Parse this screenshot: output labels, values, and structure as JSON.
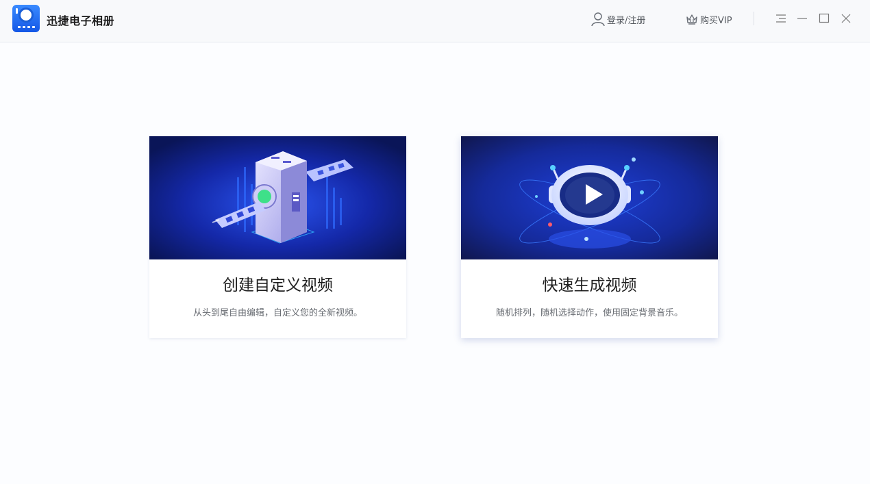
{
  "app": {
    "title": "迅捷电子相册"
  },
  "header": {
    "login_label": "登录/注册",
    "vip_label": "购买VIP"
  },
  "cards": [
    {
      "title": "创建自定义视频",
      "description": "从头到尾自由编辑，自定义您的全新视频。",
      "image_icon": "film-machine-illustration"
    },
    {
      "title": "快速生成视频",
      "description": "随机排列，随机选择动作，使用固定背景音乐。",
      "image_icon": "play-button-illustration"
    }
  ],
  "colors": {
    "brand": "#1e63ea",
    "banner_dark": "#0b1660",
    "banner_mid": "#1a3cd8"
  }
}
